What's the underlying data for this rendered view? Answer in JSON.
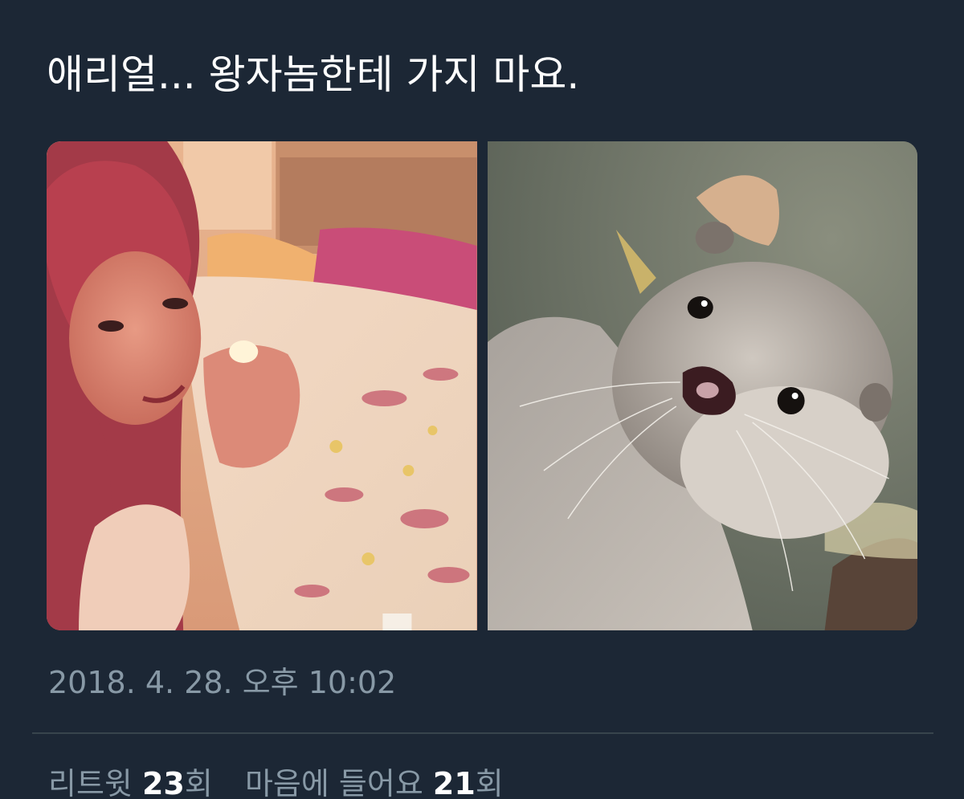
{
  "tweet": {
    "text": "애리얼... 왕자놈한테 가지 마요.",
    "timestamp": "2018. 4. 28. 오후 10:02"
  },
  "media": {
    "left_image": "photo-of-woman-with-red-hair-holding-popcorn-on-bed",
    "right_image": "photo-of-otter"
  },
  "stats": {
    "retweets_label": "리트윗",
    "retweets_count": "23",
    "retweets_suffix": "회",
    "likes_label": "마음에 들어요",
    "likes_count": "21",
    "likes_suffix": "회"
  },
  "colors": {
    "background": "#1c2735",
    "secondary_text": "#8899a6",
    "divider": "#38444d"
  }
}
